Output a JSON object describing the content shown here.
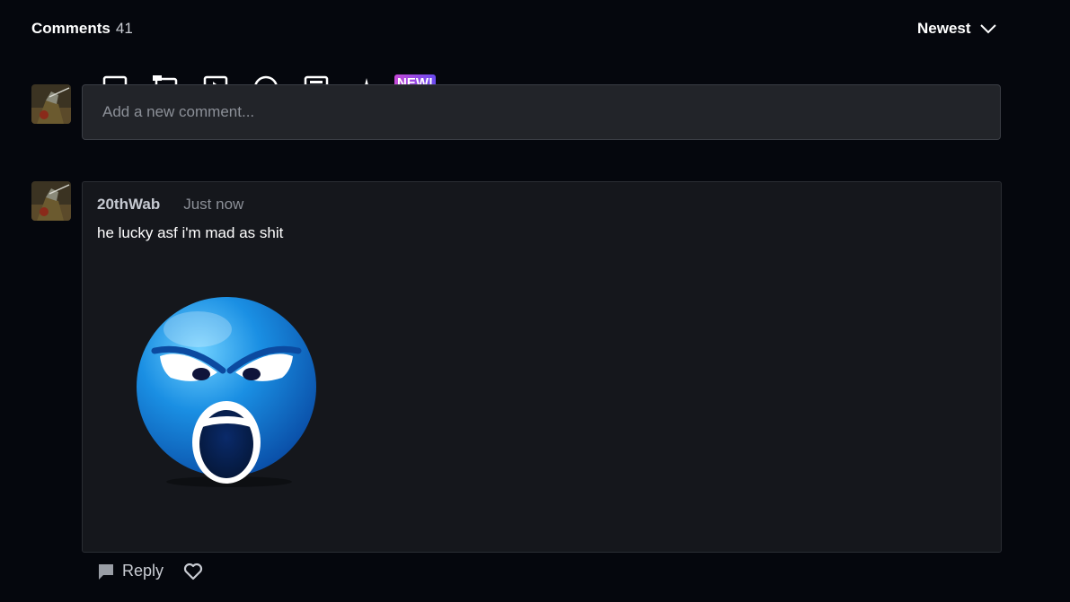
{
  "header": {
    "title": "Comments",
    "count": "41",
    "sort_label": "Newest"
  },
  "composer": {
    "placeholder": "Add a new comment...",
    "toolbar": {
      "icons": [
        "image-icon",
        "image-gallery-icon",
        "video-icon",
        "emoji-icon",
        "gif-icon",
        "sparkle-icon"
      ],
      "new_badge": "NEW!"
    }
  },
  "comments": [
    {
      "username": "20thWab",
      "timestamp": "Just now",
      "text": "he lucky asf i'm mad as shit",
      "attachment": "angry-blue-emoji",
      "reply_label": "Reply"
    }
  ],
  "colors": {
    "background": "#05070d",
    "input_bg": "#222429",
    "card_bg": "#15171c",
    "badge_gradient_start": "#c64ad6",
    "badge_gradient_end": "#6a4af0",
    "emoji_blue": "#1479d8"
  }
}
